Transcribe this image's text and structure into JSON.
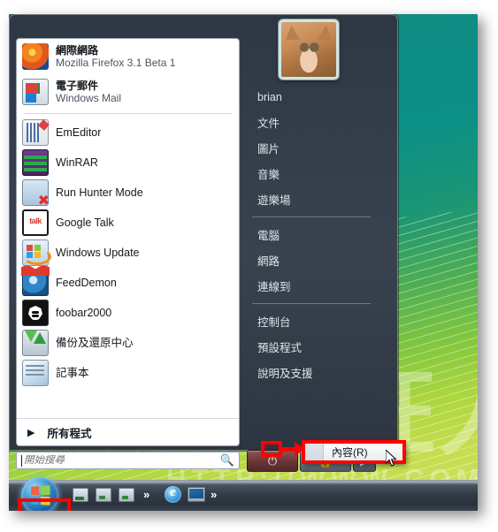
{
  "start_menu": {
    "user": {
      "name_label": "brian",
      "avatar_name": "cat-photo-avatar"
    },
    "programs": [
      {
        "title": "網際網路",
        "subtitle": "Mozilla Firefox 3.1 Beta 1",
        "icon": "firefox-icon",
        "icon_class": "ic-ff",
        "two_line": true
      },
      {
        "title": "電子郵件",
        "subtitle": "Windows Mail",
        "icon": "windows-mail-icon",
        "icon_class": "ic-mail",
        "two_line": true
      },
      {
        "title": "EmEditor",
        "subtitle": "",
        "icon": "emeditor-icon",
        "icon_class": "ic-emed",
        "two_line": false
      },
      {
        "title": "WinRAR",
        "subtitle": "",
        "icon": "winrar-icon",
        "icon_class": "ic-rar",
        "two_line": false
      },
      {
        "title": "Run Hunter Mode",
        "subtitle": "",
        "icon": "run-hunter-mode-icon",
        "icon_class": "ic-hunt",
        "two_line": false
      },
      {
        "title": "Google Talk",
        "subtitle": "",
        "icon": "google-talk-icon",
        "icon_class": "ic-talk",
        "two_line": false
      },
      {
        "title": "Windows Update",
        "subtitle": "",
        "icon": "windows-update-icon",
        "icon_class": "ic-wu",
        "two_line": false
      },
      {
        "title": "FeedDemon",
        "subtitle": "",
        "icon": "feeddemon-icon",
        "icon_class": "ic-fd",
        "two_line": false
      },
      {
        "title": "foobar2000",
        "subtitle": "",
        "icon": "foobar2000-icon",
        "icon_class": "ic-foo",
        "two_line": false
      },
      {
        "title": "備份及還原中心",
        "subtitle": "",
        "icon": "backup-restore-icon",
        "icon_class": "ic-bk",
        "two_line": false
      },
      {
        "title": "記事本",
        "subtitle": "",
        "icon": "notepad-icon",
        "icon_class": "ic-np",
        "two_line": false
      }
    ],
    "all_programs": {
      "label": "所有程式",
      "arrow_icon": "triangle-right-icon"
    },
    "search": {
      "placeholder": "開始搜尋",
      "value": "",
      "icon": "search-icon"
    },
    "right_items": [
      {
        "label": "brian",
        "separator_after": false
      },
      {
        "label": "文件",
        "separator_after": false
      },
      {
        "label": "圖片",
        "separator_after": false
      },
      {
        "label": "音樂",
        "separator_after": false
      },
      {
        "label": "遊樂場",
        "separator_after": true
      },
      {
        "label": "電腦",
        "separator_after": false
      },
      {
        "label": "網路",
        "separator_after": false
      },
      {
        "label": "連線到",
        "separator_after": true
      },
      {
        "label": "控制台",
        "separator_after": false
      },
      {
        "label": "預設程式",
        "separator_after": false
      },
      {
        "label": "說明及支援",
        "separator_after": false
      }
    ],
    "power_buttons": [
      {
        "name": "power-button",
        "glyph": "⏻",
        "color": "#6a3437"
      },
      {
        "name": "lock-button",
        "glyph": "🔒",
        "color": "#6d767f"
      },
      {
        "name": "shutdown-options-button",
        "glyph": "▶",
        "color": "#656e77"
      }
    ]
  },
  "context_menu": {
    "items": [
      {
        "label": "內容(R)"
      }
    ]
  },
  "taskbar": {
    "start_orb": "windows-start-orb",
    "quick_launch": [
      "show-desktop-icon",
      "media-icon",
      "media-icon-2",
      "internet-explorer-icon",
      "switch-window-icon"
    ],
    "overflow_glyph": "»"
  },
  "annotations": {
    "accent_color": "#ff0000",
    "boxes": [
      "start-orb-highlight",
      "properties-menu-highlight",
      "right-click-point-highlight"
    ],
    "arrow": "red-arrow-pointer"
  },
  "watermark": {
    "main": "重灌狂人",
    "sub": "HTTP://WWW.COM"
  }
}
